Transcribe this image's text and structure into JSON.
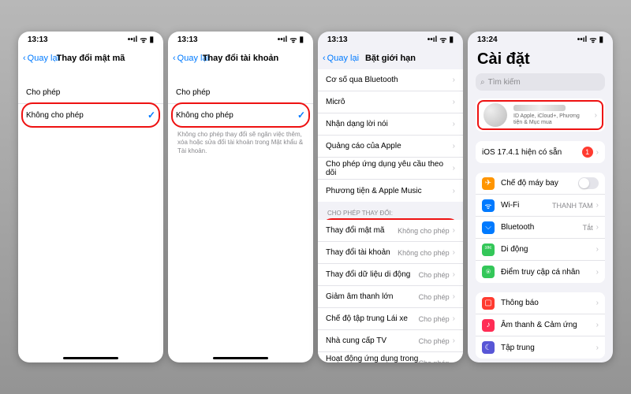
{
  "status": {
    "time1": "13:13",
    "time2": "13:24"
  },
  "screen1": {
    "back": "Quay lại",
    "title": "Thay đổi mật mã",
    "allow": "Cho phép",
    "deny": "Không cho phép"
  },
  "screen2": {
    "back": "Quay lại",
    "title": "Thay đổi tài khoản",
    "allow": "Cho phép",
    "deny": "Không cho phép",
    "footnote": "Không cho phép thay đổi sẽ ngăn việc thêm, xóa hoặc sửa đổi tài khoản trong Mật khẩu & Tài khoản."
  },
  "screen3": {
    "back": "Quay lại",
    "title": "Bặt giới hạn",
    "rows_top": [
      {
        "label": "Cơ số qua Bluetooth"
      },
      {
        "label": "Micrô"
      },
      {
        "label": "Nhận dạng lời nói"
      },
      {
        "label": "Quảng cáo của Apple"
      },
      {
        "label": "Cho phép ứng dụng yêu cầu theo dõi"
      },
      {
        "label": "Phương tiện & Apple Music"
      }
    ],
    "group_header": "CHO PHÉP THAY ĐỔI:",
    "rows_changes": [
      {
        "label": "Thay đổi mật mã",
        "value": "Không cho phép"
      },
      {
        "label": "Thay đổi tài khoản",
        "value": "Không cho phép"
      },
      {
        "label": "Thay đổi dữ liệu di động",
        "value": "Cho phép"
      },
      {
        "label": "Giảm âm thanh lớn",
        "value": "Cho phép"
      },
      {
        "label": "Chế độ tập trung Lái xe",
        "value": "Cho phép"
      },
      {
        "label": "Nhà cung cấp TV",
        "value": "Cho phép"
      },
      {
        "label": "Hoạt động ứng dụng trong nền",
        "value": "Cho phép"
      }
    ]
  },
  "screen4": {
    "title": "Cài đặt",
    "search_ph": "Tìm kiếm",
    "profile_sub": "ID Apple, iCloud+, Phương tiện & Mục mua",
    "update": "iOS 17.4.1 hiện có sẵn",
    "rows": [
      {
        "icon": "✈",
        "bg": "#ff9500",
        "label": "Chế độ máy bay",
        "type": "toggle"
      },
      {
        "icon": "ᯤ",
        "bg": "#007aff",
        "label": "Wi-Fi",
        "value": "THANH TAM"
      },
      {
        "icon": "⌵",
        "bg": "#007aff",
        "label": "Bluetooth",
        "value": "Tắt"
      },
      {
        "icon": "⎃",
        "bg": "#34c759",
        "label": "Di động",
        "value": ""
      },
      {
        "icon": "⍟",
        "bg": "#34c759",
        "label": "Điểm truy cập cá nhân",
        "value": ""
      }
    ],
    "rows2": [
      {
        "icon": "▢",
        "bg": "#ff3b30",
        "label": "Thông báo"
      },
      {
        "icon": "♪",
        "bg": "#ff2d55",
        "label": "Âm thanh & Cảm ứng"
      },
      {
        "icon": "☾",
        "bg": "#5856d6",
        "label": "Tập trung"
      }
    ]
  }
}
